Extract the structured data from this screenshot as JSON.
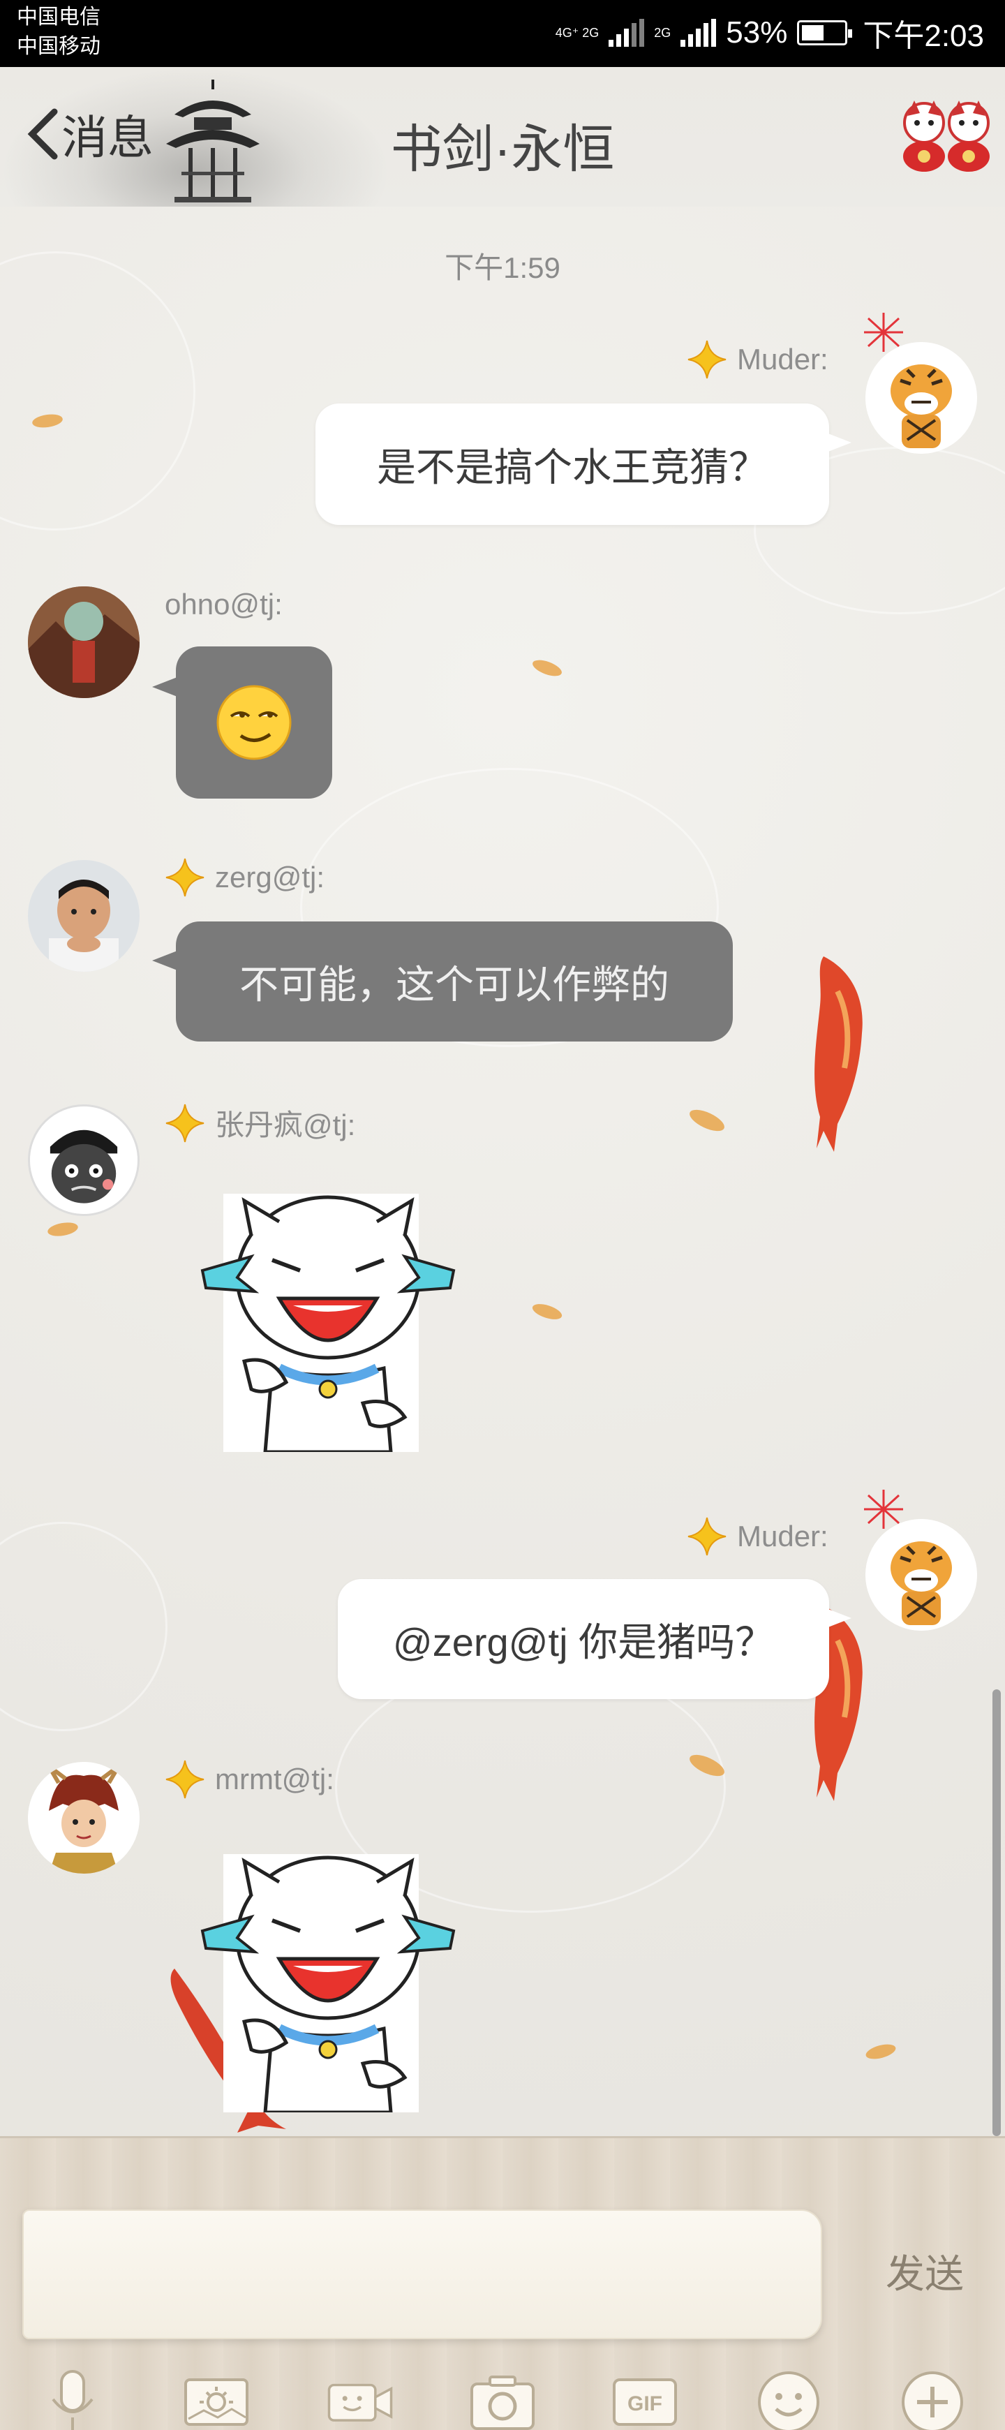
{
  "status_bar": {
    "carrier_1": "中国电信",
    "carrier_2": "中国移动",
    "network_1": "4G⁺ 2G",
    "network_2": "2G",
    "battery_percent": "53%",
    "battery_level": 0.53,
    "time": "下午2:03"
  },
  "header": {
    "back_label": "消息",
    "title": "书剑·永恒",
    "icons": [
      "back-chevron-icon",
      "pagoda-icon",
      "lucky-dolls-icon"
    ]
  },
  "chat": {
    "timestamp": "下午1:59",
    "messages": [
      {
        "sender": "Muder:",
        "side": "right",
        "type": "text",
        "text": "是不是搞个水王竞猜？",
        "bubble": "white"
      },
      {
        "sender": "ohno@tj:",
        "side": "left",
        "type": "emoji",
        "emoji": "smirk-face-icon",
        "bubble": "gray"
      },
      {
        "sender": "zerg@tj:",
        "side": "left",
        "type": "text",
        "text": "不可能，这个可以作弊的",
        "bubble": "gray"
      },
      {
        "sender": "张丹疯@tj:",
        "side": "left",
        "type": "sticker",
        "sticker": "laughing-cat-sticker"
      },
      {
        "sender": "Muder:",
        "side": "right",
        "type": "text",
        "text": "@zerg@tj 你是猪吗？",
        "bubble": "white"
      },
      {
        "sender": "mrmt@tj:",
        "side": "left",
        "type": "sticker",
        "sticker": "laughing-cat-sticker"
      }
    ]
  },
  "input": {
    "placeholder": "",
    "send_label": "发送"
  },
  "toolbar": [
    "microphone-icon",
    "photo-album-icon",
    "video-call-icon",
    "camera-icon",
    "gif-icon",
    "emoji-icon",
    "plus-icon"
  ],
  "colors": {
    "background": "#ecebe7",
    "white_bubble": "#ffffff",
    "gray_bubble": "#7a7a7a",
    "badge_star": "#f6c21c",
    "koi": "#e0482a"
  }
}
